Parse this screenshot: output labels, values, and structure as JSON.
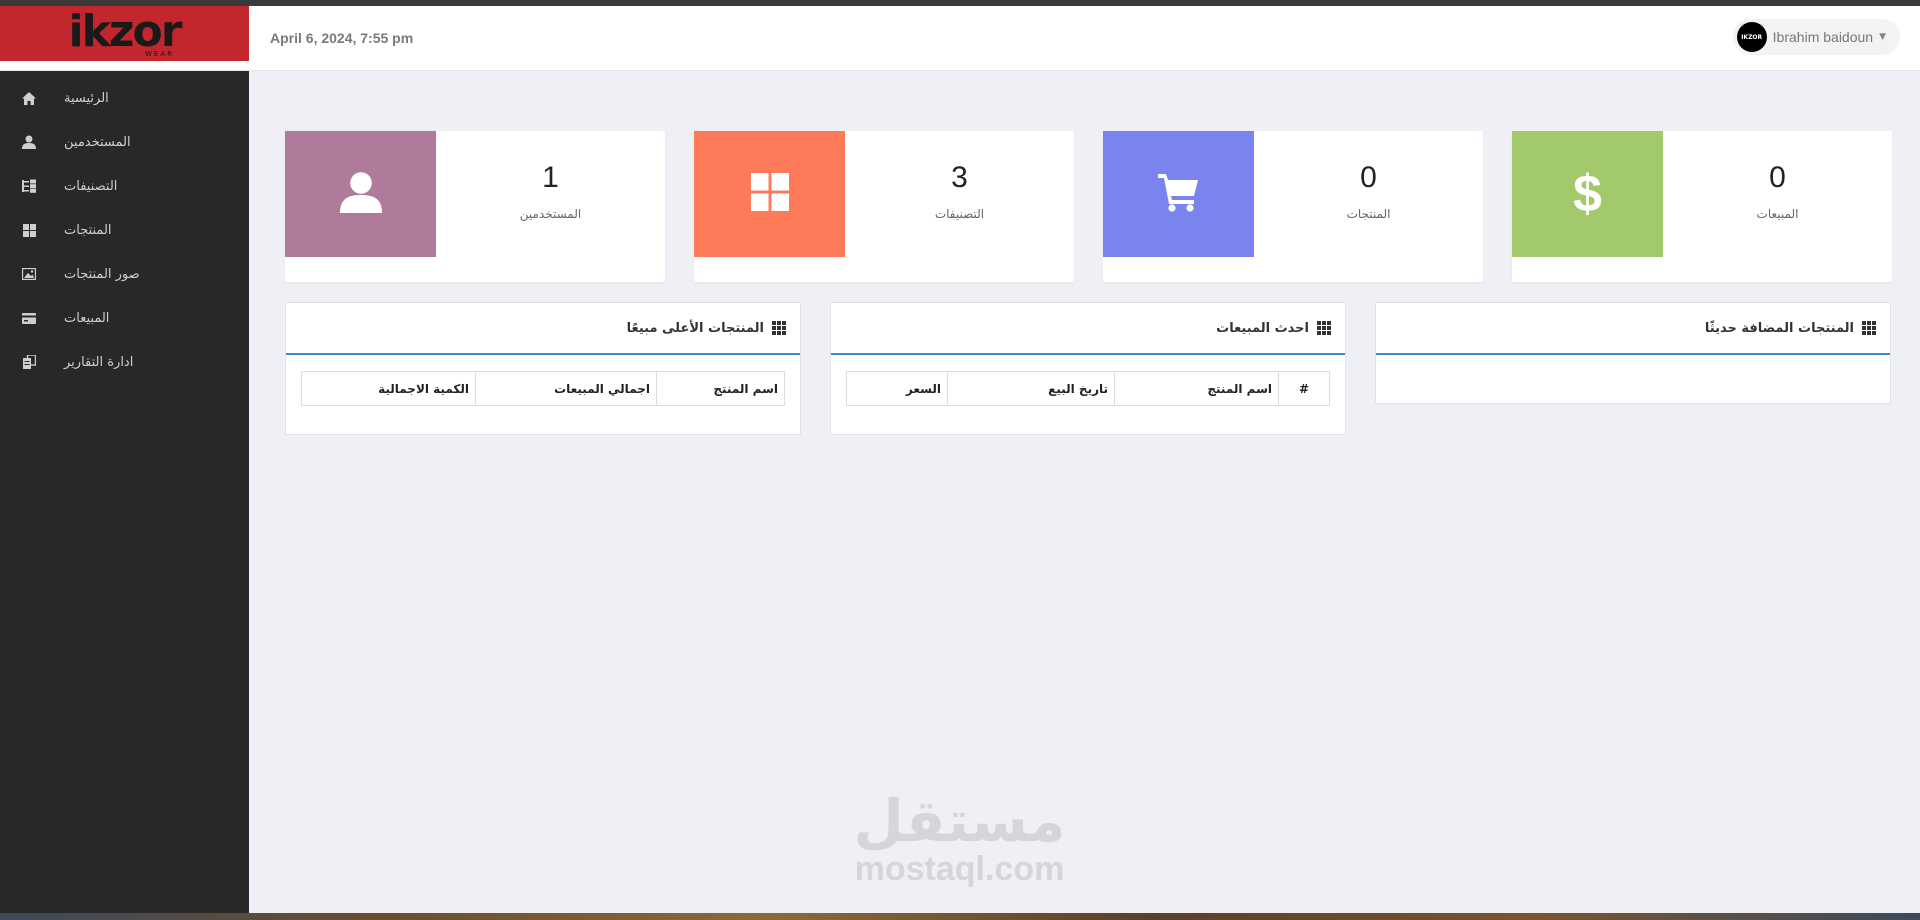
{
  "header": {
    "logo_text": "ikzor",
    "logo_sub": "WEAR",
    "datetime": "April 6, 2024, 7:55 pm",
    "user_name": "Ibrahim baidoun",
    "avatar_text": "IKZOR",
    "colors": {
      "logo_bg": "#c1272d"
    }
  },
  "sidebar": {
    "items": [
      {
        "label": "الرئيسية",
        "icon": "home-icon"
      },
      {
        "label": "المستخدمين",
        "icon": "user-icon"
      },
      {
        "label": "التصنيفات",
        "icon": "tree-icon"
      },
      {
        "label": "المنتجات",
        "icon": "grid-icon"
      },
      {
        "label": "صور المنتجات",
        "icon": "image-icon"
      },
      {
        "label": "المبيعات",
        "icon": "credit-card-icon"
      },
      {
        "label": "ادارة التقارير",
        "icon": "duplicate-icon"
      }
    ]
  },
  "stats": [
    {
      "value": "1",
      "label": "المستخدمين",
      "icon": "user-icon",
      "color": "#b07a9b"
    },
    {
      "value": "3",
      "label": "التصنيفات",
      "icon": "grid-icon",
      "color": "#fe7a58"
    },
    {
      "value": "0",
      "label": "المنتجات",
      "icon": "cart-icon",
      "color": "#7b84ee"
    },
    {
      "value": "0",
      "label": "المبيعات",
      "icon": "dollar-icon",
      "color": "#a3c96d"
    }
  ],
  "panels": {
    "top_selling": {
      "title": "المنتجات الأعلى مبيعًا",
      "columns": [
        "اسم المنتج",
        "اجمالي المبيعات",
        "الكمية الاجمالية"
      ]
    },
    "recent_sales": {
      "title": "احدث المبيعات",
      "columns": [
        "#",
        "اسم المنتج",
        "تاريخ البيع",
        "السعر"
      ]
    },
    "recent_products": {
      "title": "المنتجات المضافة حديثًا"
    }
  },
  "watermark": {
    "arabic": "مستقل",
    "latin": "mostaql.com"
  }
}
